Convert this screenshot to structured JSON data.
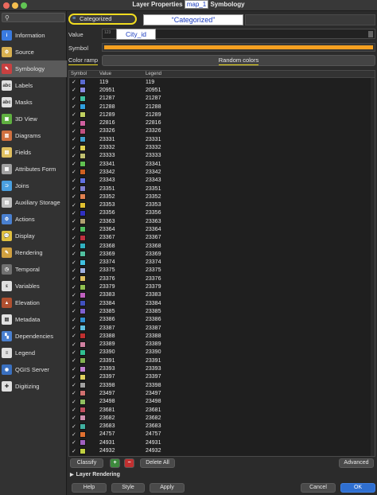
{
  "window": {
    "title_prefix": "Layer Properties",
    "title_highlight": "map_1",
    "title_suffix": "Symbology"
  },
  "sidebar": {
    "items": [
      {
        "label": "Information",
        "icon": "info-icon",
        "color": "#3a7be0",
        "glyph": "i"
      },
      {
        "label": "Source",
        "icon": "source-icon",
        "color": "#d8b050",
        "glyph": "⚙"
      },
      {
        "label": "Symbology",
        "icon": "symbology-icon",
        "color": "#c84040",
        "glyph": "✎",
        "active": true
      },
      {
        "label": "Labels",
        "icon": "labels-icon",
        "color": "#e0e0e0",
        "glyph": "abc"
      },
      {
        "label": "Masks",
        "icon": "masks-icon",
        "color": "#e0e0e0",
        "glyph": "abc"
      },
      {
        "label": "3D View",
        "icon": "3d-view-icon",
        "color": "#5fb040",
        "glyph": "▣"
      },
      {
        "label": "Diagrams",
        "icon": "diagrams-icon",
        "color": "#d07040",
        "glyph": "▥"
      },
      {
        "label": "Fields",
        "icon": "fields-icon",
        "color": "#e0c060",
        "glyph": "▤"
      },
      {
        "label": "Attributes Form",
        "icon": "attributes-form-icon",
        "color": "#a0a0a0",
        "glyph": "▦"
      },
      {
        "label": "Joins",
        "icon": "joins-icon",
        "color": "#4aa0e0",
        "glyph": "⊃"
      },
      {
        "label": "Auxiliary Storage",
        "icon": "auxiliary-storage-icon",
        "color": "#c0c0c0",
        "glyph": "▧"
      },
      {
        "label": "Actions",
        "icon": "actions-icon",
        "color": "#4a80d0",
        "glyph": "⚙"
      },
      {
        "label": "Display",
        "icon": "display-icon",
        "color": "#e0c040",
        "glyph": "💬"
      },
      {
        "label": "Rendering",
        "icon": "rendering-icon",
        "color": "#d0a040",
        "glyph": "✎"
      },
      {
        "label": "Temporal",
        "icon": "temporal-icon",
        "color": "#707070",
        "glyph": "◷"
      },
      {
        "label": "Variables",
        "icon": "variables-icon",
        "color": "#e0e0e0",
        "glyph": "ε"
      },
      {
        "label": "Elevation",
        "icon": "elevation-icon",
        "color": "#b05030",
        "glyph": "▲"
      },
      {
        "label": "Metadata",
        "icon": "metadata-icon",
        "color": "#e0e0e0",
        "glyph": "▤"
      },
      {
        "label": "Dependencies",
        "icon": "dependencies-icon",
        "color": "#4a80d0",
        "glyph": "▚"
      },
      {
        "label": "Legend",
        "icon": "legend-icon",
        "color": "#e0e0e0",
        "glyph": "≡"
      },
      {
        "label": "QGIS Server",
        "icon": "qgis-server-icon",
        "color": "#3a70c0",
        "glyph": "◉"
      },
      {
        "label": "Digitizing",
        "icon": "digitizing-icon",
        "color": "#e0e0e0",
        "glyph": "✚"
      }
    ]
  },
  "renderer": {
    "selected": "Categorized",
    "callout": "“Categorized”"
  },
  "value": {
    "label": "Value",
    "exp_hint": "123",
    "callout": "City_id"
  },
  "symbol": {
    "label": "Symbol",
    "color": "#f5a020"
  },
  "color_ramp": {
    "label": "Color ramp",
    "button": "Random colors"
  },
  "table": {
    "headers": {
      "symbol": "Symbol",
      "value": "Value",
      "legend": "Legend"
    },
    "rows": [
      {
        "value": "119",
        "legend": "119",
        "color": "#5a6ad0"
      },
      {
        "value": "20951",
        "legend": "20951",
        "color": "#8a8ae0"
      },
      {
        "value": "21287",
        "legend": "21287",
        "color": "#40c0a0"
      },
      {
        "value": "21288",
        "legend": "21288",
        "color": "#30a0e0"
      },
      {
        "value": "21289",
        "legend": "21289",
        "color": "#c0d060"
      },
      {
        "value": "22816",
        "legend": "22816",
        "color": "#d060a0"
      },
      {
        "value": "23326",
        "legend": "23326",
        "color": "#c05080"
      },
      {
        "value": "23331",
        "legend": "23331",
        "color": "#40a0d0"
      },
      {
        "value": "23332",
        "legend": "23332",
        "color": "#e0d050"
      },
      {
        "value": "23333",
        "legend": "23333",
        "color": "#c0c070"
      },
      {
        "value": "23341",
        "legend": "23341",
        "color": "#60c050"
      },
      {
        "value": "23342",
        "legend": "23342",
        "color": "#d06020"
      },
      {
        "value": "23343",
        "legend": "23343",
        "color": "#6070e0"
      },
      {
        "value": "23351",
        "legend": "23351",
        "color": "#8080d0"
      },
      {
        "value": "23352",
        "legend": "23352",
        "color": "#e08050"
      },
      {
        "value": "23353",
        "legend": "23353",
        "color": "#e0c030"
      },
      {
        "value": "23356",
        "legend": "23356",
        "color": "#3030c0"
      },
      {
        "value": "23363",
        "legend": "23363",
        "color": "#b0a070"
      },
      {
        "value": "23364",
        "legend": "23364",
        "color": "#50c060"
      },
      {
        "value": "23367",
        "legend": "23367",
        "color": "#c03040"
      },
      {
        "value": "23368",
        "legend": "23368",
        "color": "#30b0c0"
      },
      {
        "value": "23369",
        "legend": "23369",
        "color": "#50c0a0"
      },
      {
        "value": "23374",
        "legend": "23374",
        "color": "#40c0e0"
      },
      {
        "value": "23375",
        "legend": "23375",
        "color": "#a0b0e0"
      },
      {
        "value": "23376",
        "legend": "23376",
        "color": "#e0c060"
      },
      {
        "value": "23379",
        "legend": "23379",
        "color": "#90c050"
      },
      {
        "value": "23383",
        "legend": "23383",
        "color": "#c060c0"
      },
      {
        "value": "23384",
        "legend": "23384",
        "color": "#4050c0"
      },
      {
        "value": "23385",
        "legend": "23385",
        "color": "#8060d0"
      },
      {
        "value": "23386",
        "legend": "23386",
        "color": "#3090d0"
      },
      {
        "value": "23387",
        "legend": "23387",
        "color": "#60c0e0"
      },
      {
        "value": "23388",
        "legend": "23388",
        "color": "#c03030"
      },
      {
        "value": "23389",
        "legend": "23389",
        "color": "#d080a0"
      },
      {
        "value": "23390",
        "legend": "23390",
        "color": "#30c090"
      },
      {
        "value": "23391",
        "legend": "23391",
        "color": "#80b050"
      },
      {
        "value": "23393",
        "legend": "23393",
        "color": "#c080d0"
      },
      {
        "value": "23397",
        "legend": "23397",
        "color": "#e0d060"
      },
      {
        "value": "23398",
        "legend": "23398",
        "color": "#a0a0a0"
      },
      {
        "value": "23497",
        "legend": "23497",
        "color": "#d07070"
      },
      {
        "value": "23498",
        "legend": "23498",
        "color": "#90c060"
      },
      {
        "value": "23681",
        "legend": "23681",
        "color": "#c05060"
      },
      {
        "value": "23682",
        "legend": "23682",
        "color": "#d090b0"
      },
      {
        "value": "23683",
        "legend": "23683",
        "color": "#40b0a0"
      },
      {
        "value": "24757",
        "legend": "24757",
        "color": "#e07030"
      },
      {
        "value": "24931",
        "legend": "24931",
        "color": "#a060c0"
      },
      {
        "value": "24932",
        "legend": "24932",
        "color": "#c0d040"
      }
    ]
  },
  "toolbar": {
    "classify": "Classify",
    "plus": "+",
    "minus": "−",
    "delete_all": "Delete All",
    "advanced": "Advanced"
  },
  "layer_rendering": {
    "label": "Layer Rendering",
    "arrow": "▶"
  },
  "footer": {
    "help": "Help",
    "style": "Style",
    "apply": "Apply",
    "cancel": "Cancel",
    "ok": "OK"
  }
}
